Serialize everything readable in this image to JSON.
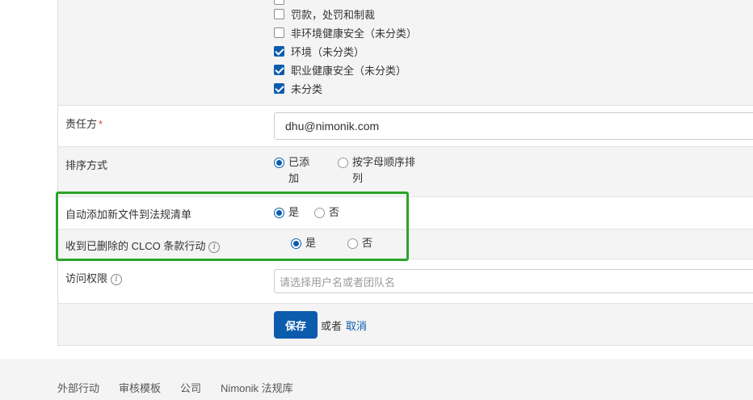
{
  "categories": {
    "items": [
      {
        "label": "罚款，处罚和制裁",
        "checked": false
      },
      {
        "label": "非环境健康安全（未分类）",
        "checked": false
      },
      {
        "label": "环境（未分类）",
        "checked": true
      },
      {
        "label": "职业健康安全（未分类）",
        "checked": true
      },
      {
        "label": "未分类",
        "checked": true
      }
    ]
  },
  "responsible": {
    "label": "责任方",
    "required_mark": "*",
    "value": "dhu@nimonik.com"
  },
  "sort": {
    "label": "排序方式",
    "options": [
      {
        "label": "已添加",
        "selected": true
      },
      {
        "label": "按字母顺序排列",
        "selected": false
      }
    ]
  },
  "auto_add": {
    "label": "自动添加新文件到法规清单",
    "options": [
      {
        "label": "是",
        "selected": true
      },
      {
        "label": "否",
        "selected": false
      }
    ]
  },
  "clco": {
    "label": "收到已删除的 CLCO 条款行动",
    "info_icon": "i",
    "options": [
      {
        "label": "是",
        "selected": true
      },
      {
        "label": "否",
        "selected": false
      }
    ]
  },
  "access": {
    "label": "访问权限",
    "info_icon": "i",
    "placeholder": "请选择用户名或者团队名"
  },
  "actions": {
    "save_label": "保存",
    "or_label": "或者",
    "cancel_label": "取消"
  },
  "footer": {
    "links": [
      "外部行动",
      "审核模板",
      "公司",
      "Nimonik 法规库"
    ]
  },
  "colors": {
    "primary": "#0b5cad",
    "highlight": "#2aa52a",
    "required": "#e0443c"
  }
}
